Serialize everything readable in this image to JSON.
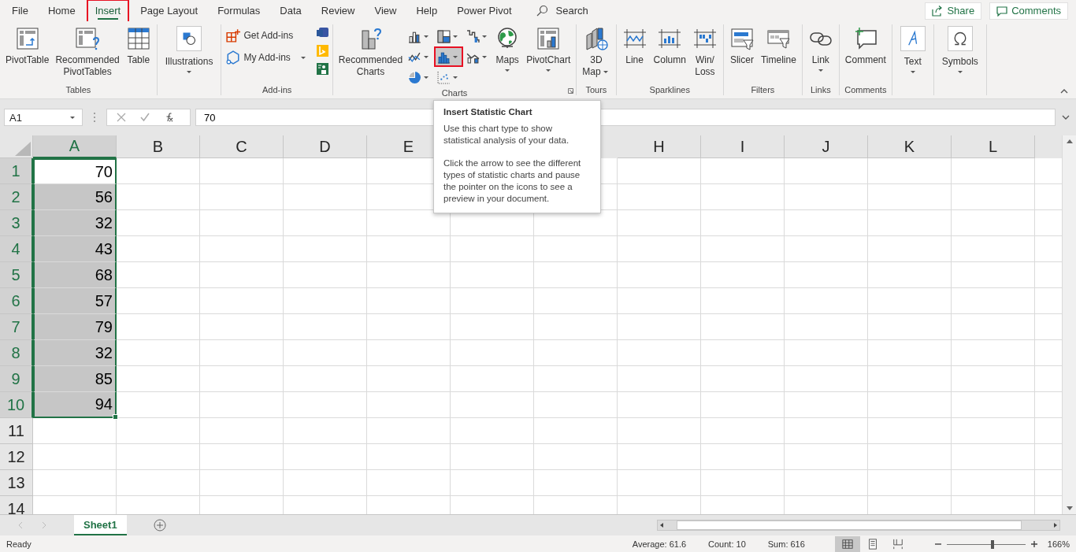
{
  "tabs": [
    {
      "label": "File",
      "selected": false,
      "annotated": false
    },
    {
      "label": "Home",
      "selected": false,
      "annotated": false
    },
    {
      "label": "Insert",
      "selected": true,
      "annotated": true
    },
    {
      "label": "Page Layout",
      "selected": false,
      "annotated": false
    },
    {
      "label": "Formulas",
      "selected": false,
      "annotated": false
    },
    {
      "label": "Data",
      "selected": false,
      "annotated": false
    },
    {
      "label": "Review",
      "selected": false,
      "annotated": false
    },
    {
      "label": "View",
      "selected": false,
      "annotated": false
    },
    {
      "label": "Help",
      "selected": false,
      "annotated": false
    },
    {
      "label": "Power Pivot",
      "selected": false,
      "annotated": false
    }
  ],
  "search": {
    "placeholder": "Search"
  },
  "share_button": "Share",
  "comments_button": "Comments",
  "ribbon": {
    "groups": [
      {
        "label": "Tables",
        "items": [
          {
            "kind": "large",
            "lines": [
              "PivotTable"
            ]
          },
          {
            "kind": "large",
            "lines": [
              "Recommended",
              "PivotTables"
            ]
          },
          {
            "kind": "large",
            "lines": [
              "Table"
            ]
          }
        ]
      },
      {
        "items": [
          {
            "kind": "boxed",
            "lines": [
              "Illustrations"
            ],
            "dropdown": true
          }
        ]
      },
      {
        "label": "Add-ins",
        "items": [
          {
            "kind": "small",
            "label": "Get Add-ins",
            "dropdown": false
          },
          {
            "kind": "small",
            "label": "My Add-ins",
            "dropdown": true
          },
          {
            "kind": "apps"
          }
        ]
      },
      {
        "label": "Charts",
        "launcher": true,
        "items": [
          {
            "kind": "large",
            "lines": [
              "Recommended",
              "Charts"
            ]
          },
          {
            "kind": "chart-grid",
            "buttons": [
              {
                "selected": false,
                "annotated": false
              },
              {
                "selected": false,
                "annotated": false
              },
              {
                "selected": false,
                "annotated": false
              },
              {
                "selected": false,
                "annotated": false
              },
              {
                "selected": true,
                "annotated": true
              },
              {
                "selected": false,
                "annotated": false
              },
              {
                "selected": false,
                "annotated": false
              },
              {
                "selected": false,
                "annotated": false
              }
            ]
          },
          {
            "kind": "large",
            "lines": [
              "Maps"
            ],
            "dropdown": true
          },
          {
            "kind": "large",
            "lines": [
              "PivotChart"
            ],
            "dropdown": true
          }
        ]
      },
      {
        "label": "Tours",
        "items": [
          {
            "kind": "large",
            "lines": [
              "3D",
              "Map"
            ],
            "dropdown": true
          }
        ]
      },
      {
        "label": "Sparklines",
        "items": [
          {
            "kind": "large",
            "lines": [
              "Line"
            ]
          },
          {
            "kind": "large",
            "lines": [
              "Column"
            ]
          },
          {
            "kind": "large",
            "lines": [
              "Win/",
              "Loss"
            ]
          }
        ]
      },
      {
        "label": "Filters",
        "items": [
          {
            "kind": "large",
            "lines": [
              "Slicer"
            ]
          },
          {
            "kind": "large",
            "lines": [
              "Timeline"
            ]
          }
        ]
      },
      {
        "label": "Links",
        "items": [
          {
            "kind": "large",
            "lines": [
              "Link"
            ],
            "dropdown": true
          }
        ]
      },
      {
        "label": "Comments",
        "items": [
          {
            "kind": "large",
            "lines": [
              "Comment"
            ]
          }
        ]
      },
      {
        "items": [
          {
            "kind": "boxed",
            "lines": [
              "Text"
            ],
            "dropdown": true
          }
        ]
      },
      {
        "items": [
          {
            "kind": "boxed",
            "lines": [
              "Symbols"
            ],
            "dropdown": true
          }
        ]
      }
    ]
  },
  "formula_bar": {
    "name_box": "A1",
    "value": "70"
  },
  "sheet": {
    "columns": [
      {
        "label": "A",
        "selected": true
      },
      {
        "label": "B",
        "selected": false
      },
      {
        "label": "C",
        "selected": false
      },
      {
        "label": "D",
        "selected": false
      },
      {
        "label": "E",
        "selected": false
      },
      null,
      null,
      {
        "label": "H",
        "selected": false
      },
      {
        "label": "I",
        "selected": false
      },
      {
        "label": "J",
        "selected": false
      },
      {
        "label": "K",
        "selected": false
      },
      {
        "label": "L",
        "selected": false
      }
    ],
    "rows": [
      {
        "header": "1",
        "selected": true,
        "active": true,
        "value": "70"
      },
      {
        "header": "2",
        "selected": true,
        "active": false,
        "value": "56"
      },
      {
        "header": "3",
        "selected": true,
        "active": false,
        "value": "32"
      },
      {
        "header": "4",
        "selected": true,
        "active": false,
        "value": "43"
      },
      {
        "header": "5",
        "selected": true,
        "active": false,
        "value": "68"
      },
      {
        "header": "6",
        "selected": true,
        "active": false,
        "value": "57"
      },
      {
        "header": "7",
        "selected": true,
        "active": false,
        "value": "79"
      },
      {
        "header": "8",
        "selected": true,
        "active": false,
        "value": "32"
      },
      {
        "header": "9",
        "selected": true,
        "active": false,
        "value": "85"
      },
      {
        "header": "10",
        "selected": true,
        "active": false,
        "value": "94"
      },
      {
        "header": "11",
        "selected": false,
        "active": false
      },
      {
        "header": "12",
        "selected": false,
        "active": false
      },
      {
        "header": "13",
        "selected": false,
        "active": false
      },
      {
        "header": "14",
        "selected": false,
        "active": false
      }
    ]
  },
  "tooltip": {
    "title": "Insert Statistic Chart",
    "paragraphs": [
      "Use this chart type to show statistical analysis of your data.",
      "Click the arrow to see the different types of statistic charts and pause the pointer on the icons to see a preview in your document."
    ]
  },
  "sheet_tabs": [
    {
      "label": "Sheet1",
      "selected": true
    }
  ],
  "status_bar": {
    "mode": "Ready",
    "average": "Average: 61.6",
    "count": "Count: 10",
    "sum": "Sum: 616",
    "views": [
      {
        "selected": true
      },
      {
        "selected": false
      },
      {
        "selected": false
      }
    ],
    "zoom": {
      "level": 0.58,
      "label": "166%"
    }
  }
}
